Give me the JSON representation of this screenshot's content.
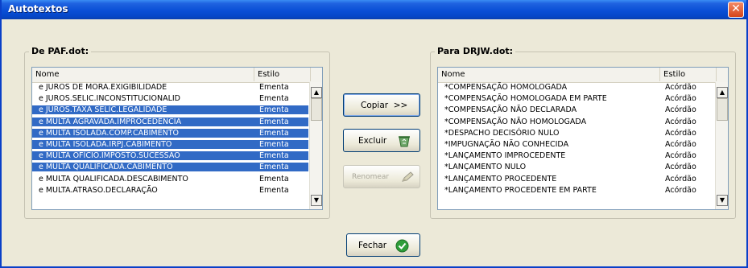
{
  "window": {
    "title": "Autotextos"
  },
  "source": {
    "label": "De PAF.dot:",
    "columns": [
      "Nome",
      "Estilo"
    ],
    "rows": [
      {
        "name": "e JUROS DE MORA.EXIGIBILIDADE",
        "style": "Ementa",
        "selected": false
      },
      {
        "name": "e JUROS.SELIC.INCONSTITUCIONALID",
        "style": "Ementa",
        "selected": false
      },
      {
        "name": "e JUROS.TAXA SELIC.LEGALIDADE",
        "style": "Ementa",
        "selected": true
      },
      {
        "name": "e MULTA AGRAVADA.IMPROCEDÊNCIA",
        "style": "Ementa",
        "selected": true
      },
      {
        "name": "e MULTA ISOLADA.COMP.CABIMENTO",
        "style": "Ementa",
        "selected": true
      },
      {
        "name": "e MULTA ISOLADA.IRPJ.CABIMENTO",
        "style": "Ementa",
        "selected": true
      },
      {
        "name": "e MULTA OFÍCIO.IMPOSTO.SUCESSÃO",
        "style": "Ementa",
        "selected": true
      },
      {
        "name": "e MULTA QUALIFICADA.CABIMENTO",
        "style": "Ementa",
        "selected": true
      },
      {
        "name": "e MULTA QUALIFICADA.DESCABIMENTO",
        "style": "Ementa",
        "selected": false
      },
      {
        "name": "e MULTA.ATRASO.DECLARAÇÃO",
        "style": "Ementa",
        "selected": false
      }
    ]
  },
  "target": {
    "label": "Para DRJW.dot:",
    "columns": [
      "Nome",
      "Estilo"
    ],
    "rows": [
      {
        "name": "*COMPENSAÇÃO HOMOLOGADA",
        "style": "Acórdão"
      },
      {
        "name": "*COMPENSAÇÃO HOMOLOGADA EM PARTE",
        "style": "Acórdão"
      },
      {
        "name": "*COMPENSAÇÃO NÃO DECLARADA",
        "style": "Acórdão"
      },
      {
        "name": "*COMPENSAÇÃO NÃO HOMOLOGADA",
        "style": "Acórdão"
      },
      {
        "name": "*DESPACHO DECISÓRIO NULO",
        "style": "Acórdão"
      },
      {
        "name": "*IMPUGNAÇÃO NÃO CONHECIDA",
        "style": "Acórdão"
      },
      {
        "name": "*LANÇAMENTO IMPROCEDENTE",
        "style": "Acórdão"
      },
      {
        "name": "*LANÇAMENTO NULO",
        "style": "Acórdão"
      },
      {
        "name": "*LANÇAMENTO PROCEDENTE",
        "style": "Acórdão"
      },
      {
        "name": "*LANÇAMENTO PROCEDENTE EM PARTE",
        "style": "Acórdão"
      }
    ]
  },
  "buttons": {
    "copy": "Copiar  >>",
    "delete": "Excluir",
    "rename": "Renomear",
    "close": "Fechar"
  },
  "icons": {
    "close": "close-icon",
    "delete": "recycle-bin-icon",
    "rename": "pencil-icon",
    "ok": "green-check-icon"
  }
}
